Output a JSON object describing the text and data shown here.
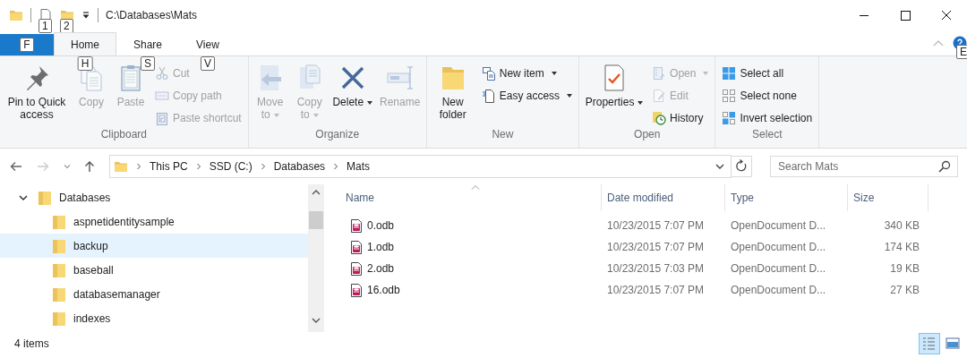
{
  "window": {
    "title": "C:\\Databases\\Mats"
  },
  "quick_access": {
    "keytips": [
      "1",
      "2"
    ]
  },
  "ribbon": {
    "tabs": [
      {
        "kind": "file",
        "keytip": "F",
        "selected": false
      },
      {
        "kind": "tab",
        "label": "Home",
        "keytip": "H",
        "selected": true
      },
      {
        "kind": "tab",
        "label": "Share",
        "keytip": "S",
        "selected": false
      },
      {
        "kind": "tab",
        "label": "View",
        "keytip": "V",
        "selected": false
      }
    ],
    "help_keytip": "E",
    "groups": [
      {
        "label": "Clipboard",
        "commands": [
          {
            "kind": "large",
            "label": "Pin to Quick access",
            "disabled": false,
            "dropdown": false
          },
          {
            "kind": "large",
            "label": "Copy",
            "disabled": true,
            "dropdown": false
          },
          {
            "kind": "large",
            "label": "Paste",
            "disabled": true,
            "dropdown": false
          },
          {
            "kind": "small",
            "label": "Cut",
            "disabled": true,
            "dropdown": false
          },
          {
            "kind": "small",
            "label": "Copy path",
            "disabled": true,
            "dropdown": false
          },
          {
            "kind": "small",
            "label": "Paste shortcut",
            "disabled": true,
            "dropdown": false
          }
        ]
      },
      {
        "label": "Organize",
        "commands": [
          {
            "kind": "large",
            "label": "Move to",
            "disabled": true,
            "dropdown": true
          },
          {
            "kind": "large",
            "label": "Copy to",
            "disabled": true,
            "dropdown": true
          },
          {
            "kind": "large",
            "label": "Delete",
            "disabled": false,
            "dropdown": true
          },
          {
            "kind": "large",
            "label": "Rename",
            "disabled": true,
            "dropdown": false
          }
        ]
      },
      {
        "label": "New",
        "commands": [
          {
            "kind": "large",
            "label": "New folder",
            "disabled": false,
            "dropdown": false
          },
          {
            "kind": "small",
            "label": "New item",
            "disabled": false,
            "dropdown": true
          },
          {
            "kind": "small",
            "label": "Easy access",
            "disabled": false,
            "dropdown": true
          }
        ]
      },
      {
        "label": "Open",
        "commands": [
          {
            "kind": "large",
            "label": "Properties",
            "disabled": false,
            "dropdown": true
          },
          {
            "kind": "small",
            "label": "Open",
            "disabled": true,
            "dropdown": true
          },
          {
            "kind": "small",
            "label": "Edit",
            "disabled": true,
            "dropdown": false
          },
          {
            "kind": "small",
            "label": "History",
            "disabled": false,
            "dropdown": false
          }
        ]
      },
      {
        "label": "Select",
        "commands": [
          {
            "kind": "small",
            "label": "Select all",
            "disabled": false,
            "dropdown": false
          },
          {
            "kind": "small",
            "label": "Select none",
            "disabled": false,
            "dropdown": false
          },
          {
            "kind": "small",
            "label": "Invert selection",
            "disabled": false,
            "dropdown": false
          }
        ]
      }
    ]
  },
  "address_bar": {
    "breadcrumbs": [
      "This PC",
      "SSD (C:)",
      "Databases",
      "Mats"
    ]
  },
  "search": {
    "placeholder": "Search Mats"
  },
  "navigation": {
    "items": [
      {
        "label": "Databases",
        "expanded": true,
        "selected": false,
        "children": [
          {
            "label": "aspnetidentitysample",
            "selected": false
          },
          {
            "label": "backup",
            "selected": true
          },
          {
            "label": "baseball",
            "selected": false
          },
          {
            "label": "databasemanager",
            "selected": false
          },
          {
            "label": "indexes",
            "selected": false
          }
        ]
      }
    ]
  },
  "file_list": {
    "columns": [
      {
        "label": "Name",
        "sorted": true
      },
      {
        "label": "Date modified",
        "sorted": false
      },
      {
        "label": "Type",
        "sorted": false
      },
      {
        "label": "Size",
        "sorted": false
      }
    ],
    "rows": [
      {
        "name": "0.odb",
        "date": "10/23/2015 7:07 PM",
        "type": "OpenDocument D...",
        "size": "340 KB"
      },
      {
        "name": "1.odb",
        "date": "10/23/2015 7:07 PM",
        "type": "OpenDocument D...",
        "size": "174 KB"
      },
      {
        "name": "2.odb",
        "date": "10/23/2015 7:03 PM",
        "type": "OpenDocument D...",
        "size": "19 KB"
      },
      {
        "name": "16.odb",
        "date": "10/23/2015 7:07 PM",
        "type": "OpenDocument D...",
        "size": "27 KB"
      }
    ]
  },
  "status_bar": {
    "item_count": "4 items",
    "views": [
      {
        "kind": "details",
        "selected": true
      },
      {
        "kind": "large-icons",
        "selected": false
      }
    ]
  }
}
